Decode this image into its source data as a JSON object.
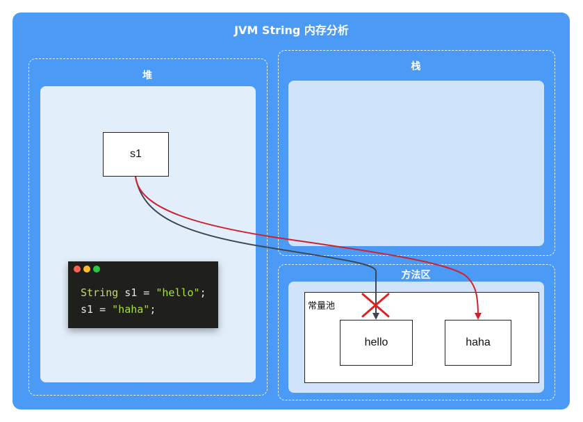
{
  "title": "JVM String 内存分析",
  "regions": {
    "heap": "堆",
    "stack": "栈",
    "method_area": "方法区"
  },
  "pool_label": "常量池",
  "heap_var": "s1",
  "pool_strings": [
    "hello",
    "haha"
  ],
  "code": {
    "line1": {
      "type": "String",
      "rest": " s1 = ",
      "literal": "\"hello\"",
      "end": ";"
    },
    "line2": {
      "rest": "s1 = ",
      "literal": "\"haha\"",
      "end": ";"
    }
  },
  "colors": {
    "background": "#4b9bf6",
    "old_reference": "#3d4650",
    "new_reference": "#d0202a",
    "cross_mark": "#e02020"
  },
  "icons": {
    "removed_reference": "cross-icon"
  }
}
